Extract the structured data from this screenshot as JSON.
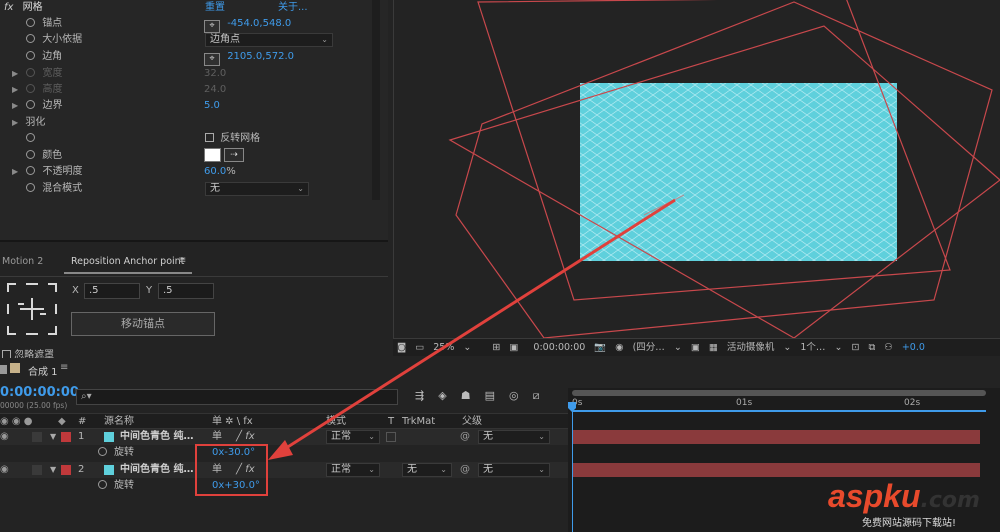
{
  "effects": {
    "fx_label": "fx",
    "effect_name": "网格",
    "reset": "重置",
    "about": "关于...",
    "props": {
      "anchor_label": "锚点",
      "anchor_value": "-454.0,548.0",
      "size_from_label": "大小依据",
      "size_from_value": "边角点",
      "corner_label": "边角",
      "corner_value": "2105.0,572.0",
      "width_label": "宽度",
      "width_value": "32.0",
      "height_label": "高度",
      "height_value": "24.0",
      "border_label": "边界",
      "border_value": "5.0",
      "feather_label": "羽化",
      "invert_label": "反转网格",
      "color_label": "颜色",
      "opacity_label": "不透明度",
      "opacity_value": "60.0",
      "opacity_unit": "%",
      "blend_label": "混合模式",
      "blend_value": "无"
    }
  },
  "motion": {
    "tab1": "Motion 2",
    "tab2": "Reposition Anchor point",
    "x_label": "X",
    "x_value": ".5",
    "y_label": "Y",
    "y_value": ".5",
    "move_button": "移动锚点",
    "ignore_mask": "忽略遮罩"
  },
  "viewer": {
    "zoom": "25%",
    "timecode": "0:00:00:00",
    "quality": "(四分…",
    "camera": "活动摄像机",
    "views": "1个…",
    "exposure": "+0.0",
    "grid_color": "#5fd0dc",
    "line_color": "#c8484c"
  },
  "timeline": {
    "comp_tab": "合成 1",
    "timecode": "0:00:00:00",
    "fps": "00000 (25.00 fps)",
    "search_placeholder": "",
    "headers": {
      "num": "#",
      "source": "源名称",
      "switches": "单 ✲ \\ fx",
      "mode": "模式",
      "t": "T",
      "trkmat": "TrkMat",
      "parent": "父级"
    },
    "ruler": [
      "0s",
      "01s",
      "02s"
    ],
    "layers": [
      {
        "num": "1",
        "name": "中间色青色 纯…",
        "mode": "正常",
        "trkmat": "",
        "parent": "无",
        "prop": "旋转",
        "prop_value": "0x-30.0°"
      },
      {
        "num": "2",
        "name": "中间色青色 纯…",
        "mode": "正常",
        "trkmat": "无",
        "parent": "无",
        "prop": "旋转",
        "prop_value": "0x+30.0°"
      }
    ],
    "layer_color": "#c0393b",
    "accent": "#3f9bea"
  },
  "watermark": {
    "brand": "aspku",
    "tld": ".com",
    "tagline": "免费网站源码下载站!"
  }
}
